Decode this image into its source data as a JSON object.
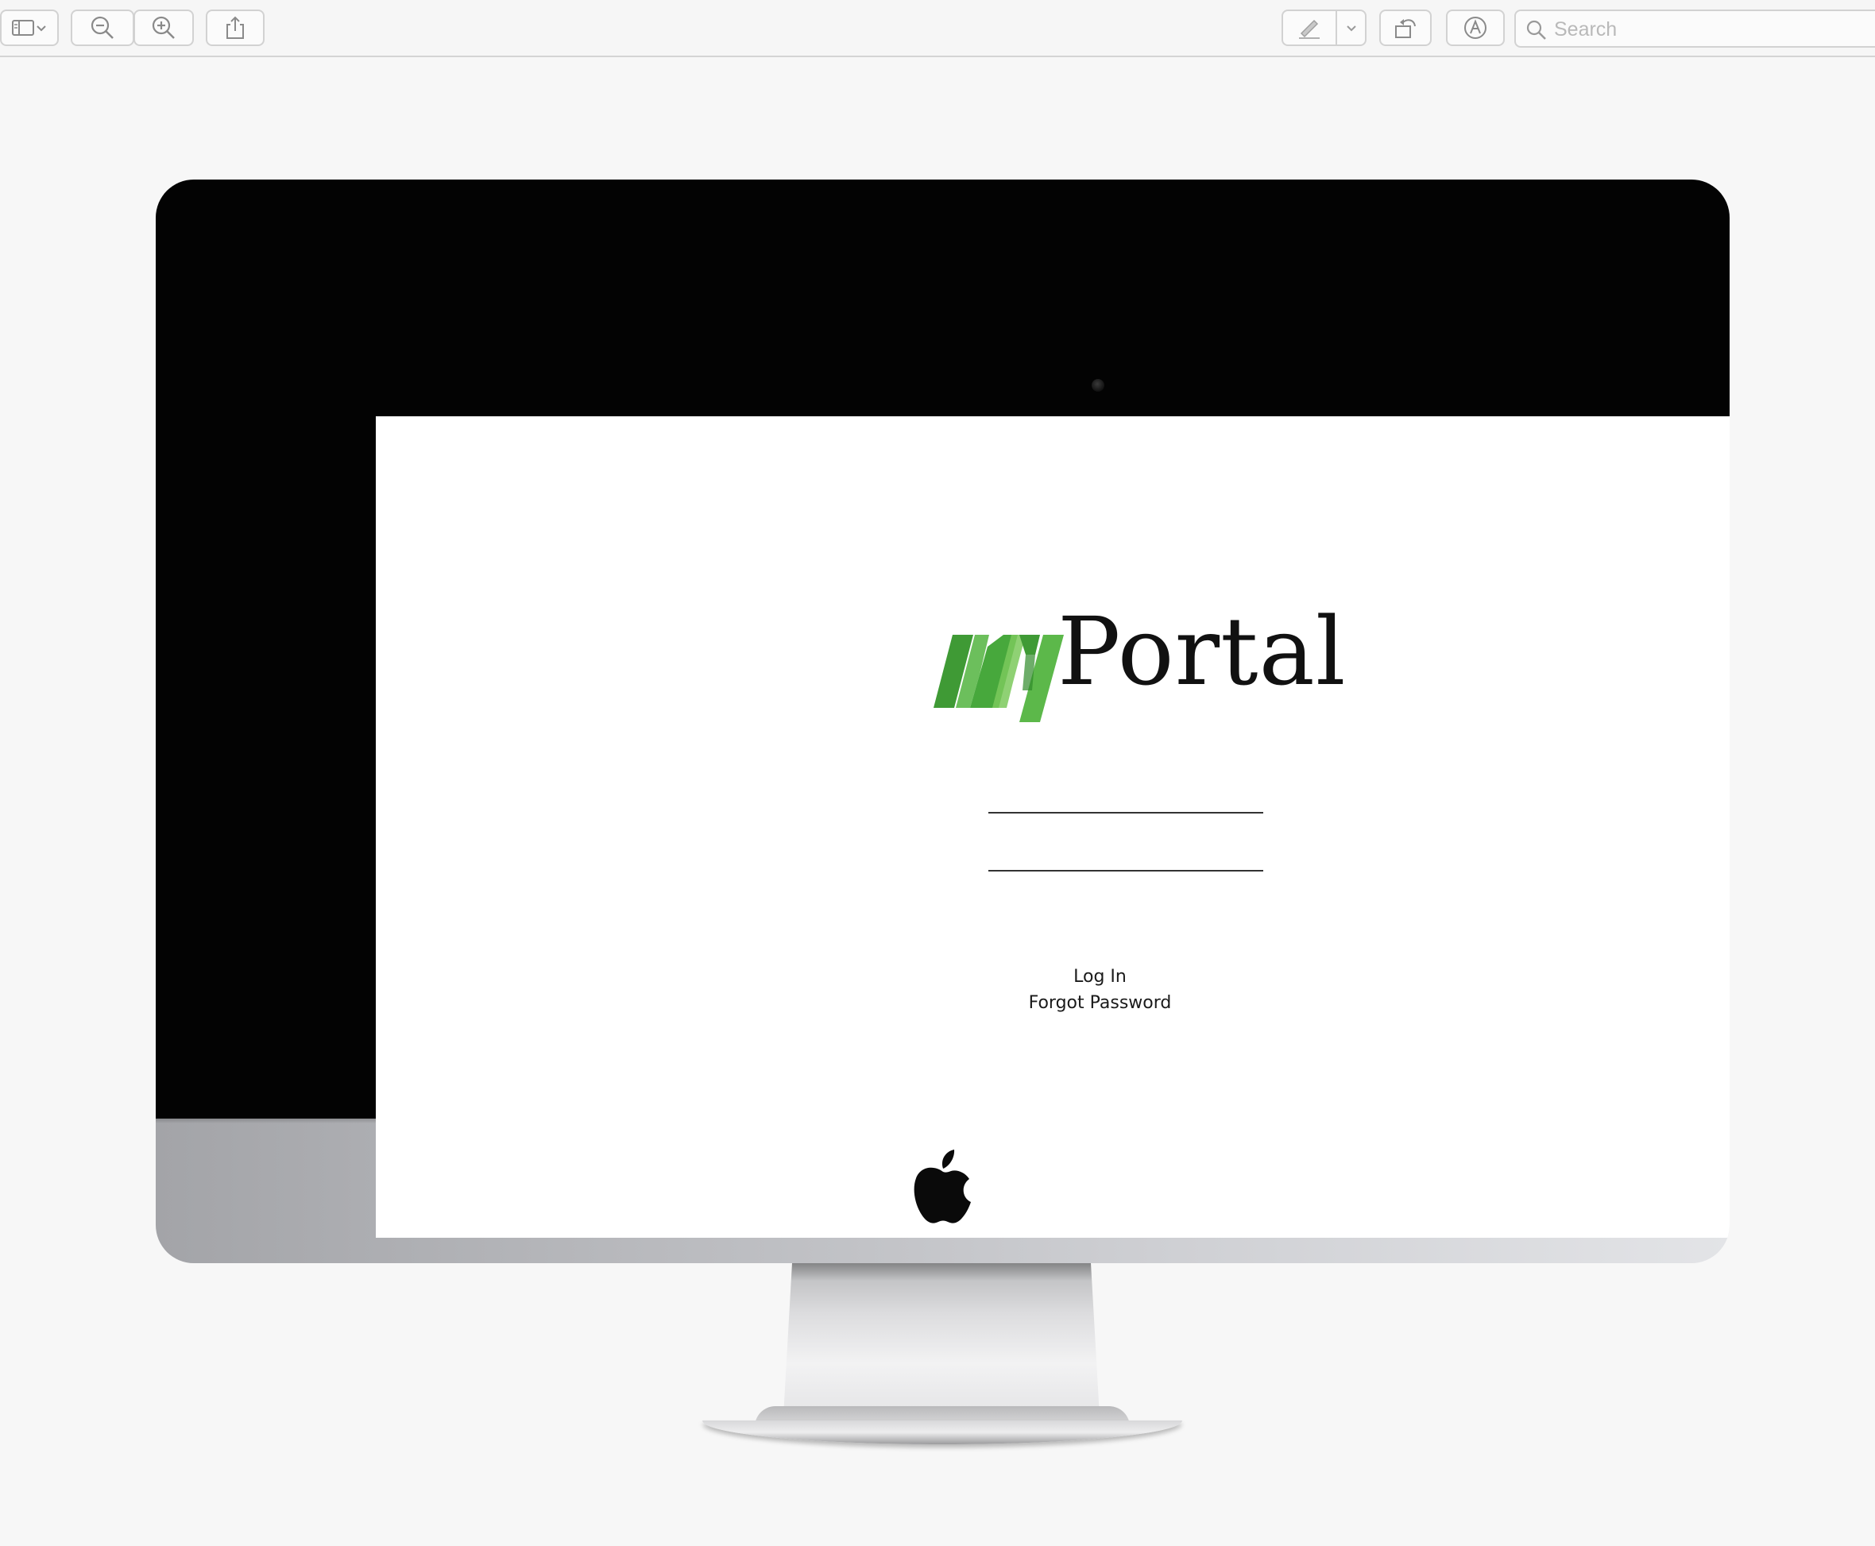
{
  "toolbar": {
    "sidebar_button": {
      "icon": "sidebar-toggle-icon",
      "menu_icon": "chevron-down-icon"
    },
    "zoom_out_button": {
      "icon": "zoom-out-icon"
    },
    "zoom_in_button": {
      "icon": "zoom-in-icon"
    },
    "share_button": {
      "icon": "share-icon"
    },
    "markup_button": {
      "icon": "pen-icon",
      "menu_icon": "chevron-down-icon"
    },
    "rotate_button": {
      "icon": "rotate-icon"
    },
    "annotate_button": {
      "icon": "markup-circle-icon"
    },
    "search": {
      "placeholder": "Search",
      "value": ""
    }
  },
  "device": {
    "camera": "camera-dot",
    "logo_icon": "apple-icon"
  },
  "screen": {
    "brand": {
      "prefix": "my",
      "name": "Portal",
      "accent_color": "#47a83c",
      "accent_light": "#6cc24a"
    },
    "username_field": {
      "value": "",
      "placeholder": ""
    },
    "password_field": {
      "value": "",
      "placeholder": ""
    },
    "login_label": "Log In",
    "forgot_label": "Forgot Password"
  }
}
